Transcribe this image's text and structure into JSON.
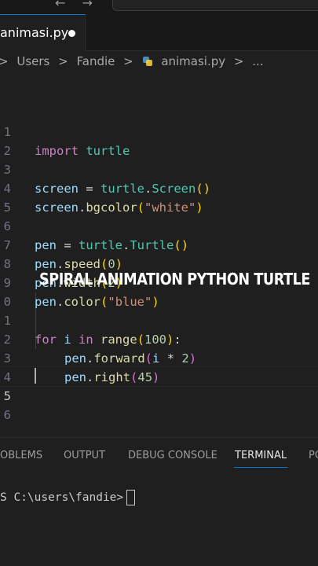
{
  "titlebar": {
    "nav_icons": "← →"
  },
  "tab": {
    "filename": "animasi.py"
  },
  "breadcrumb": {
    "items": [
      "Users",
      "Fandie",
      "animasi.py",
      "..."
    ]
  },
  "editor": {
    "line_numbers": [
      "1",
      "2",
      "3",
      "4",
      "5",
      "6",
      "7",
      "8",
      "9",
      "0",
      "1",
      "2",
      "3",
      "4",
      "5",
      "6"
    ],
    "active_line": "5"
  },
  "code": {
    "l1": {
      "kw": "import",
      "mod": "turtle"
    },
    "l3": {
      "var": "screen",
      "op": " = ",
      "mod": "turtle",
      "dot": ".",
      "fn": "Screen",
      "po": "(",
      "pc": ")"
    },
    "l4": {
      "var": "screen",
      "dot": ".",
      "fn": "bgcolor",
      "po": "(",
      "str": "\"white\"",
      "pc": ")"
    },
    "l6": {
      "var": "pen",
      "op": " = ",
      "mod": "turtle",
      "dot": ".",
      "fn": "Turtle",
      "po": "(",
      "pc": ")"
    },
    "l7": {
      "var": "pen",
      "dot": ".",
      "fn": "speed",
      "po": "(",
      "num": "0",
      "pc": ")"
    },
    "l8": {
      "var": "pen",
      "dot": ".",
      "fn": "width",
      "po": "(",
      "num": "2",
      "pc": ")"
    },
    "l9": {
      "var": "pen",
      "dot": ".",
      "fn": "color",
      "po": "(",
      "str": "\"blue\"",
      "pc": ")"
    },
    "l11": {
      "kw1": "for",
      "var": " i ",
      "kw2": "in",
      "fn": " range",
      "po": "(",
      "num": "100",
      "pc": ")",
      "colon": ":"
    },
    "l12": {
      "var": "pen",
      "dot": ".",
      "fn": "forward",
      "po": "(",
      "var2": "i",
      "op": " * ",
      "num": "2",
      "pc": ")"
    },
    "l13": {
      "var": "pen",
      "dot": ".",
      "fn": "right",
      "po": "(",
      "num": "45",
      "pc": ")"
    }
  },
  "overlay": {
    "text": "SPIRAL ANIMATION PYTHON TURTLE"
  },
  "panel": {
    "tabs": [
      "OBLEMS",
      "OUTPUT",
      "DEBUG CONSOLE",
      "TERMINAL",
      "PO"
    ],
    "active_tab": "TERMINAL"
  },
  "terminal": {
    "prompt": "S C:\\users\\fandie>"
  },
  "colors": {
    "background": "#1f1f1f",
    "accent": "#0078d4"
  }
}
